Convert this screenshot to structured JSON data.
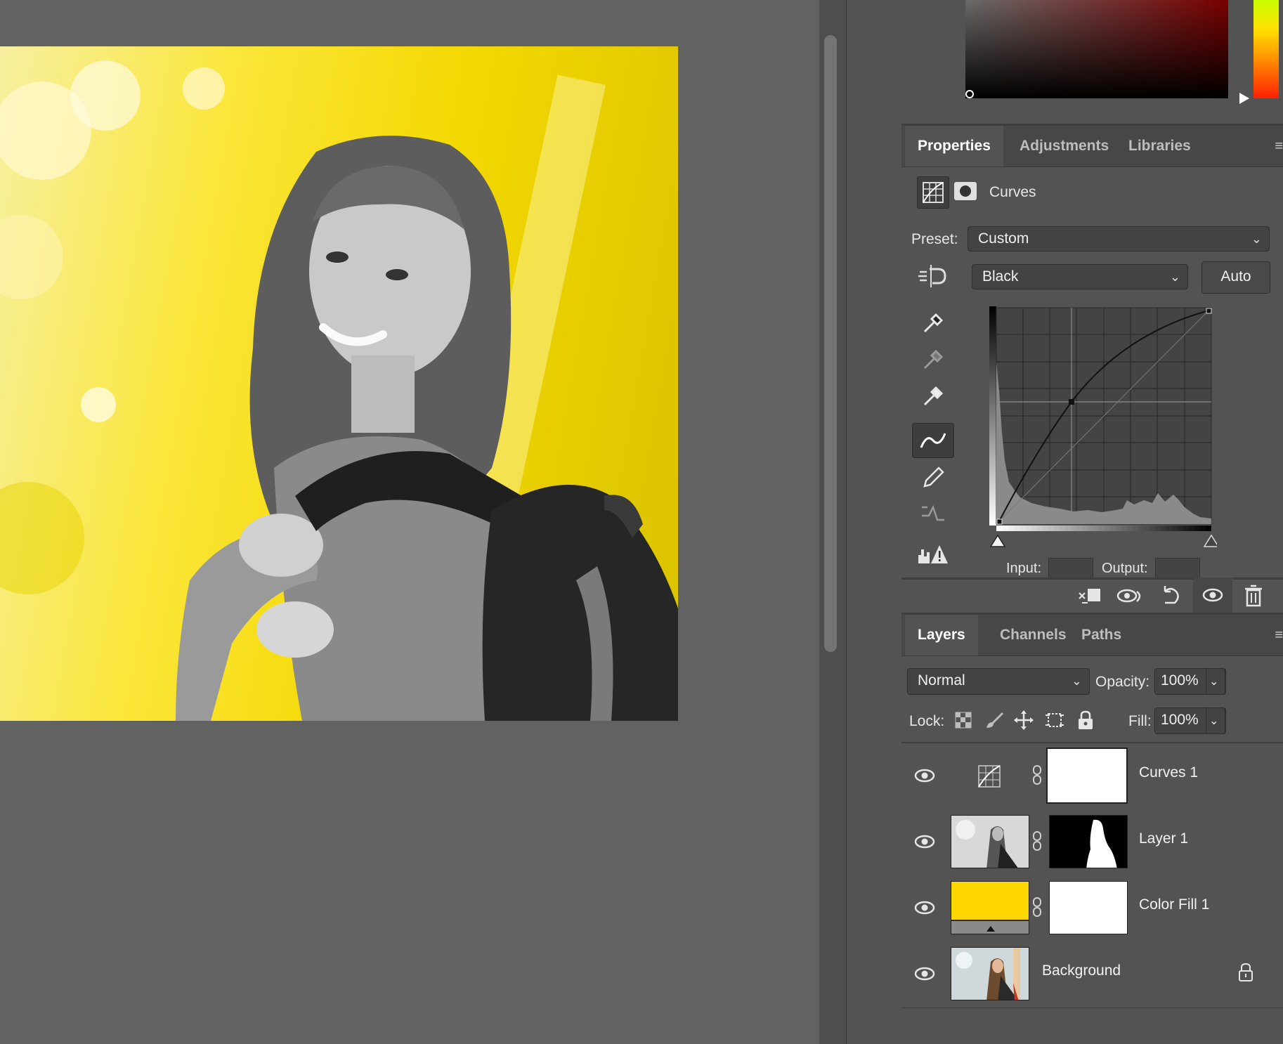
{
  "properties_panel": {
    "tabs": [
      "Properties",
      "Adjustments",
      "Libraries"
    ],
    "active_tab": "Properties",
    "adjustment_title": "Curves",
    "preset_label": "Preset:",
    "preset_value": "Custom",
    "channel_value": "Black",
    "auto_label": "Auto",
    "input_label": "Input:",
    "output_label": "Output:",
    "curve_point": {
      "input": 95,
      "output": 140
    }
  },
  "layers_panel": {
    "tabs": [
      "Layers",
      "Channels",
      "Paths"
    ],
    "active_tab": "Layers",
    "blend_mode": "Normal",
    "opacity_label": "Opacity:",
    "opacity_value": "100%",
    "lock_label": "Lock:",
    "fill_label": "Fill:",
    "fill_value": "100%",
    "layers": [
      {
        "name": "Curves 1",
        "selected": true
      },
      {
        "name": "Layer 1",
        "selected": false
      },
      {
        "name": "Color Fill 1",
        "selected": false
      },
      {
        "name": "Background",
        "selected": false,
        "locked": true
      }
    ]
  },
  "colors": {
    "fill_color": "#FFD700",
    "panel_bg": "#535353",
    "canvas_bg": "#626262"
  }
}
